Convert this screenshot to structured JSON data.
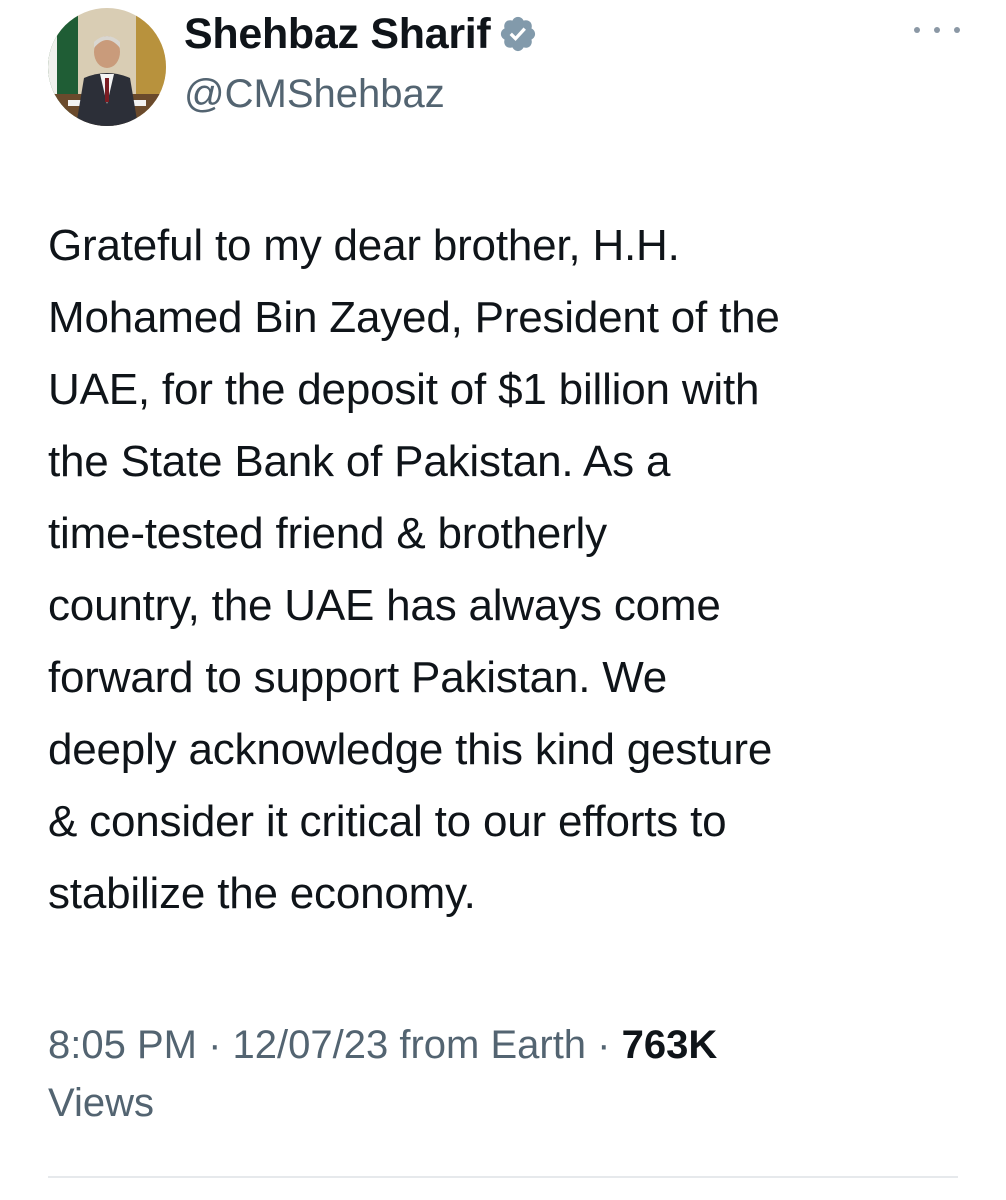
{
  "author": {
    "display_name": "Shehbaz Sharif",
    "handle": "@CMShehbaz",
    "avatar_icon": "profile-photo",
    "verified_icon": "verified-badge-icon",
    "verified_color": "#829aab"
  },
  "more_icon": "more-options-icon",
  "tweet": {
    "text": "Grateful to my dear brother, H.H.\nMohamed Bin Zayed, President of the\nUAE, for the deposit of $1 billion with\nthe State Bank of Pakistan. As a\ntime-tested friend & brotherly\ncountry, the UAE has always come\nforward to support Pakistan. We\ndeeply acknowledge this kind gesture\n& consider it critical to our efforts to\nstabilize the economy."
  },
  "meta": {
    "time": "8:05 PM",
    "separator": " · ",
    "date": "12/07/23",
    "source": " from Earth",
    "views_count": "763K",
    "views_label": "Views"
  },
  "colors": {
    "text": "#0f1419",
    "secondary": "#536471",
    "divider": "#e6e9ec"
  }
}
